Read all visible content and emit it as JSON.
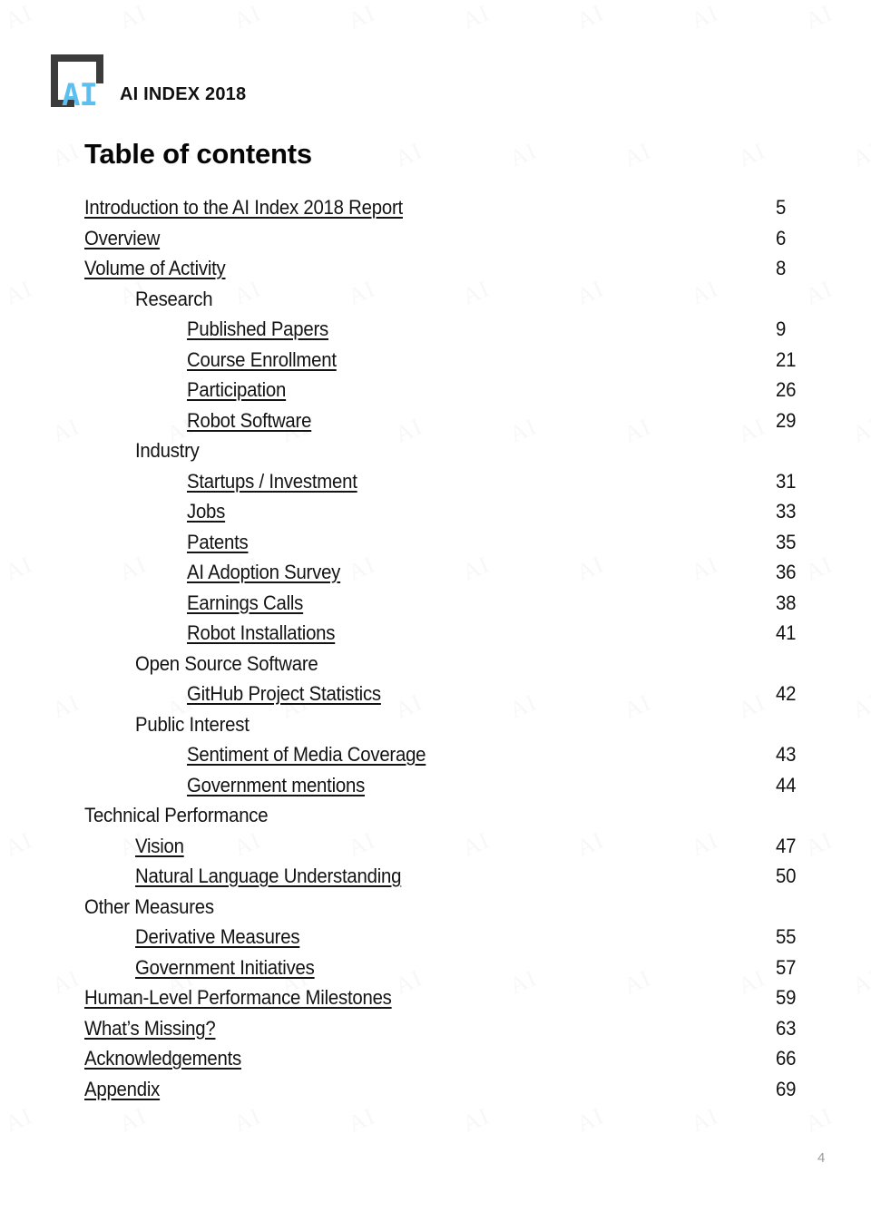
{
  "brand": {
    "logo_letters": "AI",
    "logo_accent_color": "#5bc0ef",
    "wordmark": "AI INDEX 2018"
  },
  "title": "Table of contents",
  "watermark_text": "AI",
  "toc": {
    "entries": [
      {
        "label": "Introduction to the AI Index 2018 Report",
        "page": "5",
        "level": 0,
        "linked": true
      },
      {
        "label": "Overview",
        "page": "6",
        "level": 0,
        "linked": true
      },
      {
        "label": "Volume of Activity",
        "page": "8",
        "level": 0,
        "linked": true
      },
      {
        "label": "Research",
        "page": "",
        "level": 1,
        "linked": false
      },
      {
        "label": "Published Papers",
        "page": "9",
        "level": 2,
        "linked": true
      },
      {
        "label": "Course Enrollment",
        "page": "21",
        "level": 2,
        "linked": true
      },
      {
        "label": "Participation",
        "page": "26",
        "level": 2,
        "linked": true
      },
      {
        "label": "Robot Software",
        "page": "29",
        "level": 2,
        "linked": true
      },
      {
        "label": "Industry",
        "page": "",
        "level": 1,
        "linked": false
      },
      {
        "label": "Startups / Investment",
        "page": "31",
        "level": 2,
        "linked": true
      },
      {
        "label": "Jobs",
        "page": "33",
        "level": 2,
        "linked": true
      },
      {
        "label": "Patents",
        "page": "35",
        "level": 2,
        "linked": true
      },
      {
        "label": "AI Adoption Survey",
        "page": "36",
        "level": 2,
        "linked": true
      },
      {
        "label": "Earnings Calls",
        "page": "38",
        "level": 2,
        "linked": true
      },
      {
        "label": "Robot Installations",
        "page": "41",
        "level": 2,
        "linked": true
      },
      {
        "label": "Open Source Software",
        "page": "",
        "level": 1,
        "linked": false
      },
      {
        "label": "GitHub Project Statistics",
        "page": "42",
        "level": 2,
        "linked": true
      },
      {
        "label": "Public Interest",
        "page": "",
        "level": 1,
        "linked": false
      },
      {
        "label": "Sentiment of Media Coverage",
        "page": "43",
        "level": 2,
        "linked": true
      },
      {
        "label": "Government mentions",
        "page": "44",
        "level": 2,
        "linked": true
      },
      {
        "label": "Technical Performance",
        "page": "",
        "level": 0,
        "linked": false
      },
      {
        "label": "Vision",
        "page": "47",
        "level": 1,
        "linked": true
      },
      {
        "label": "Natural Language Understanding",
        "page": "50",
        "level": 1,
        "linked": true
      },
      {
        "label": "Other Measures",
        "page": "",
        "level": 0,
        "linked": false
      },
      {
        "label": "Derivative Measures",
        "page": "55",
        "level": 1,
        "linked": true
      },
      {
        "label": "Government Initiatives",
        "page": "57",
        "level": 1,
        "linked": true
      },
      {
        "label": "Human-Level Performance Milestones",
        "page": "59",
        "level": 0,
        "linked": true
      },
      {
        "label": "What’s Missing?",
        "page": "63",
        "level": 0,
        "linked": true
      },
      {
        "label": "Acknowledgements",
        "page": "66",
        "level": 0,
        "linked": true
      },
      {
        "label": "Appendix",
        "page": "69",
        "level": 0,
        "linked": true
      }
    ]
  },
  "footer": {
    "page_number": "4"
  }
}
